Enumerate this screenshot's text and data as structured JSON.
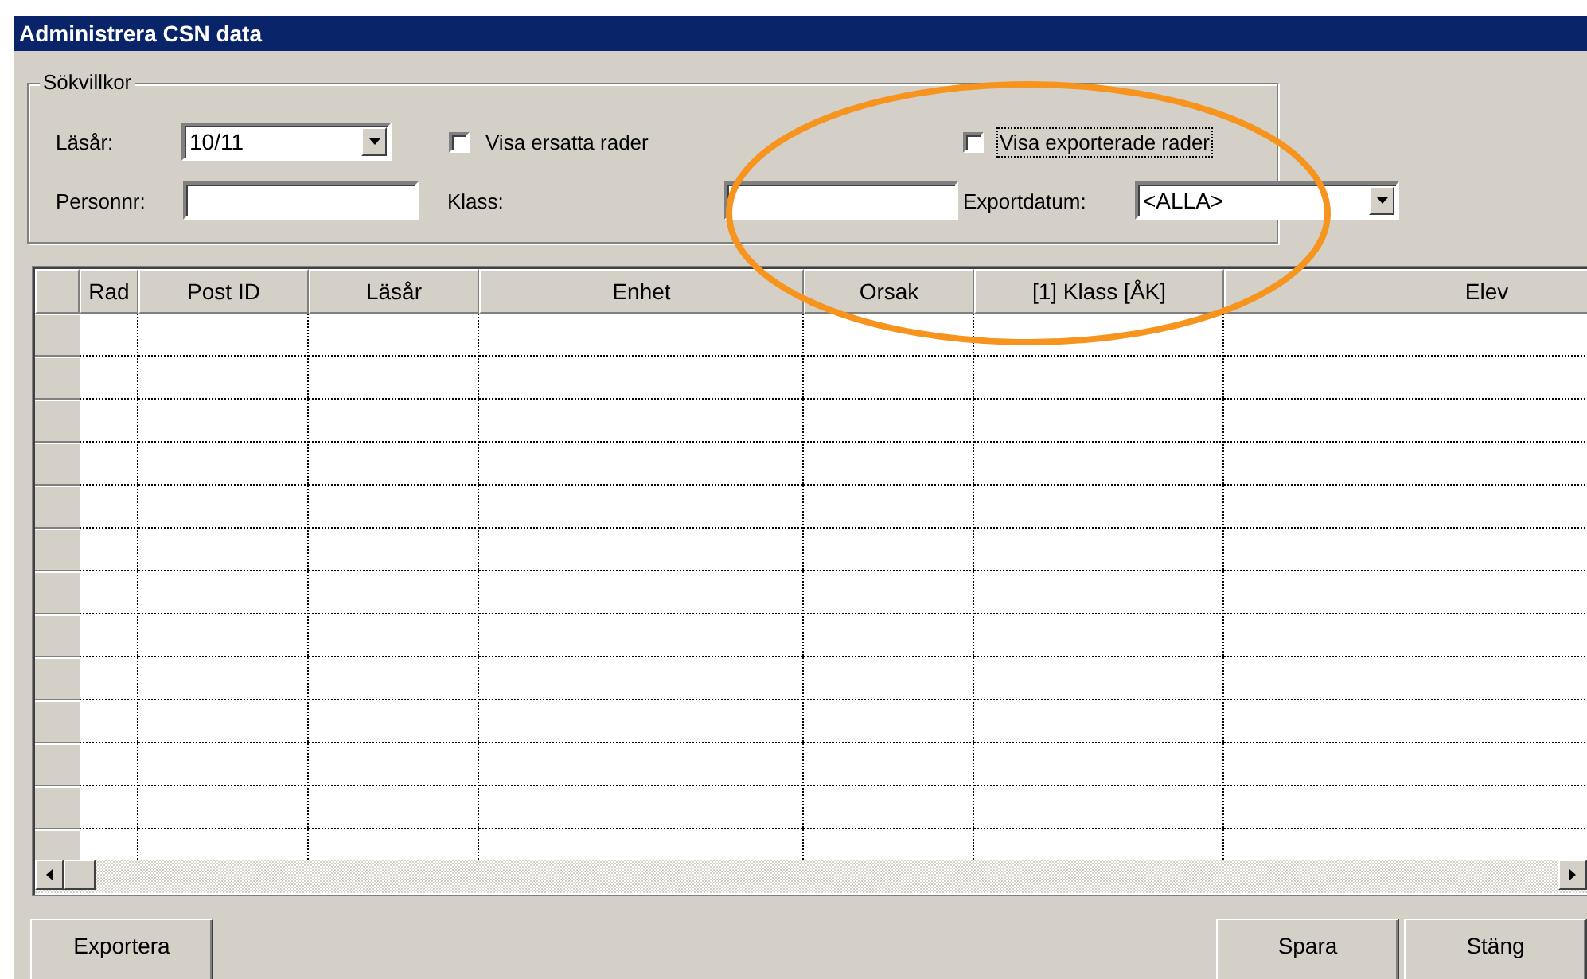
{
  "window": {
    "title": "Administrera CSN data"
  },
  "search": {
    "legend": "Sökvillkor",
    "school_year": {
      "label": "Läsår:",
      "value": "10/11"
    },
    "show_replaced": {
      "label": "Visa ersatta rader",
      "checked": false
    },
    "show_exported": {
      "label": "Visa exporterade rader",
      "checked": false,
      "focused": true
    },
    "person_number": {
      "label": "Personnr:"
    },
    "class": {
      "label": "Klass:"
    },
    "export_date": {
      "label": "Exportdatum:",
      "value": "<ALLA>"
    }
  },
  "table": {
    "columns": [
      "Rad",
      "Post ID",
      "Läsår",
      "Enhet",
      "Orsak",
      "[1] Klass [ÅK]",
      "Elev"
    ]
  },
  "buttons_left": [
    "Exportera"
  ],
  "buttons_right": [
    "Spara",
    "Stäng"
  ]
}
